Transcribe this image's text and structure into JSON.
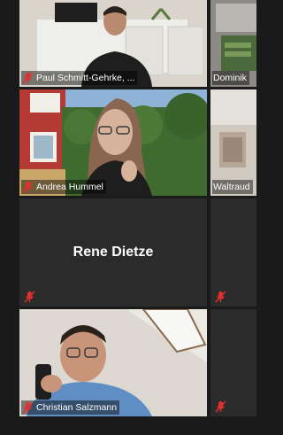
{
  "participants": [
    {
      "name": "Paul Schmitt-Gehrke, ...",
      "muted": true,
      "video": true
    },
    {
      "name": "Dominik",
      "muted": false,
      "video": true
    },
    {
      "name": "Andrea Hummel",
      "muted": true,
      "video": true
    },
    {
      "name": "Waltraud",
      "muted": false,
      "video": true
    },
    {
      "name": "Rene Dietze",
      "muted": true,
      "video": false
    },
    {
      "name": "",
      "muted": true,
      "video": false
    },
    {
      "name": "Christian Salzmann",
      "muted": true,
      "video": true
    },
    {
      "name": "",
      "muted": true,
      "video": false
    }
  ],
  "colors": {
    "background": "#1a1a1a",
    "tile_empty": "#2b2b2b",
    "mic_muted": "#e0312f",
    "text": "#ffffff"
  },
  "icons": {
    "muted_mic": "mic-muted-icon"
  }
}
